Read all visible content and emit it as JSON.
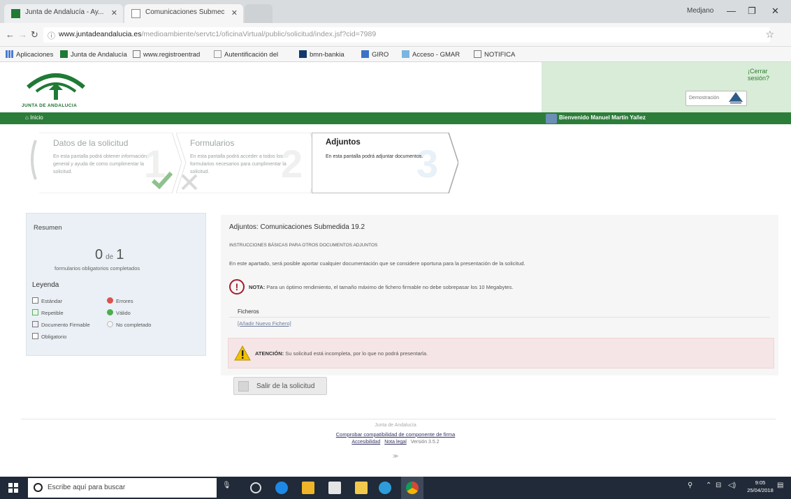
{
  "browser": {
    "tabs": [
      {
        "label": "Junta de Andalucía - Ay..."
      },
      {
        "label": "Comunicaciones Submec"
      }
    ],
    "user": "Medjano",
    "url_host": "www.juntadeandalucia.es",
    "url_path": "/medioambiente/servtc1/oficinaVirtual/public/solicitud/index.jsf?cid=7989",
    "bookmarks": [
      {
        "label": "Aplicaciones"
      },
      {
        "label": "Junta de Andalucía"
      },
      {
        "label": "www.registroentrad"
      },
      {
        "label": "Autentificación del"
      },
      {
        "label": "bmn-bankia"
      },
      {
        "label": "GIRO"
      },
      {
        "label": "Acceso - GMAR"
      },
      {
        "label": "NOTIFICA"
      }
    ]
  },
  "header": {
    "logo_text": "JUNTA DE ANDALUCIA",
    "cerrar": "¡Cerrar sesión?",
    "demo": "Demostración",
    "home": "Inicio",
    "welcome": "Bienvenido Manuel Martín Yañez"
  },
  "wizard": [
    {
      "title": "Datos de la solicitud",
      "desc": "En esta pantalla podrá obtener información general y ayuda de como cumplimentar la solicitud.",
      "num": "1"
    },
    {
      "title": "Formularios",
      "desc": "En esta pantalla podrá acceder a todos los formularios necesarios para cumplimentar la solicitud.",
      "num": "2"
    },
    {
      "title": "Adjuntos",
      "desc": "En esta pantalla podrá adjuntar documentos.",
      "num": "3"
    }
  ],
  "sidebar": {
    "title": "Resumen",
    "count_done": "0",
    "count_sep": "de",
    "count_total": "1",
    "subtitle": "formularios obligatorios completados",
    "legend_title": "Leyenda",
    "legend": {
      "estandar": "Estándar",
      "errores": "Errores",
      "repetible": "Repetible",
      "valido": "Válido",
      "firmable": "Documento Firmable",
      "no_completado": "No completado",
      "obligatorio": "Obligatorio"
    }
  },
  "main": {
    "title": "Adjuntos: Comunicaciones Submedida 19.2",
    "caps": "INSTRUCCIONES BÁSICAS PARA OTROS DOCUMENTOS ADJUNTOS",
    "text": "En este apartado, será posible aportar cualquier documentación que se considere oportuna para la presentación de la solicitud.",
    "nota_label": "NOTA:",
    "nota_text": "Para un óptimo rendimiento, el tamaño máximo de fichero firmable no debe sobrepasar los 10 Megabytes.",
    "ficheros": "Ficheros",
    "anadir": "[Añadir Nuevo Fichero]",
    "atencion_label": "ATENCIÓN:",
    "atencion_text": "Su solicitud está incompleta, por lo que no podrá presentarla.",
    "salir": "Salir de la solicitud"
  },
  "footer": {
    "org": "Junta de Andalucía",
    "comprobar": "Comprobar compatibilidad de componente de firma",
    "accesibilidad": "Accesibilidad",
    "nota_legal": "Nota legal",
    "version": "Versión 3.5.2",
    "chevron": "≫"
  },
  "taskbar": {
    "search_placeholder": "Escribe aquí para buscar",
    "time": "9:05",
    "date": "25/04/2018"
  }
}
